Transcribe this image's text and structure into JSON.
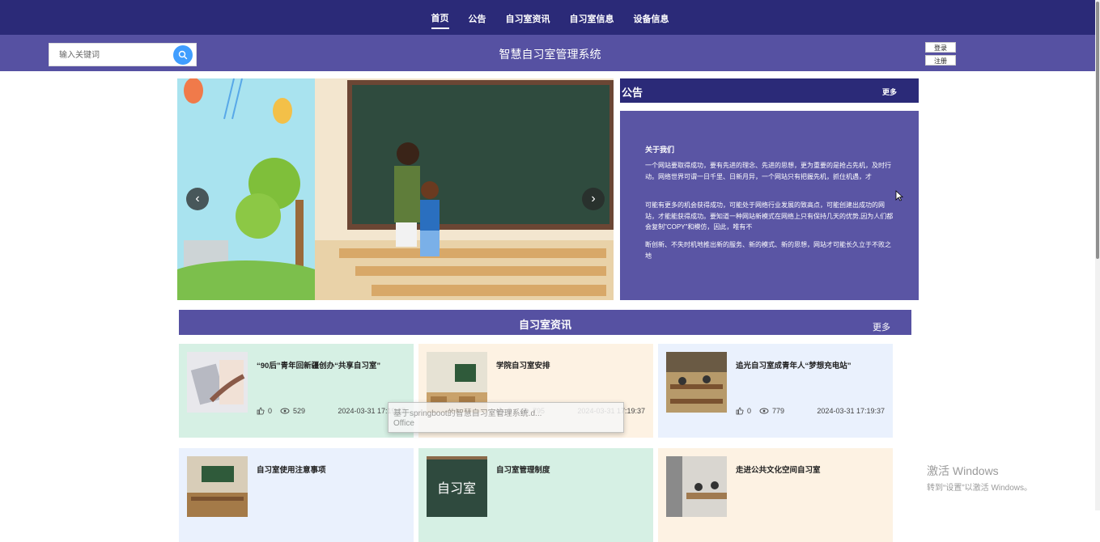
{
  "nav": {
    "items": [
      {
        "label": "首页",
        "active": true
      },
      {
        "label": "公告"
      },
      {
        "label": "自习室资讯"
      },
      {
        "label": "自习室信息"
      },
      {
        "label": "设备信息"
      }
    ]
  },
  "header": {
    "search_placeholder": "输入关键词",
    "title": "智慧自习室管理系统",
    "login_label": "登录",
    "register_label": "注册"
  },
  "banner": {
    "prev": "‹",
    "next": "›"
  },
  "notice": {
    "title": "公告",
    "more": "更多",
    "item_title": "关于我们",
    "paragraph1": "一个网站要取得成功，要有先进的理念、先进的思想，更为重要的是抢占先机，及时行动。网络世界可谓一日千里、日新月异，一个网站只有把握先机，抓住机遇，才",
    "paragraph2": "可能有更多的机会获得成功，可能处于网络行业发展的致高点，可能创建出成功的网站，才能能获得成功。要知道一种网站新模式在网络上只有保持几天的优势,因为人们都会复制\"COPY\"和模仿，因此，唯有不",
    "paragraph3": "断创新、不失时机地推出新的服务、新的模式、新的思想，网站才可能长久立于不败之地"
  },
  "news": {
    "title": "自习室资讯",
    "more": "更多",
    "cards": [
      {
        "title": "“90后”青年回新疆创办“共享自习室”",
        "likes": "0",
        "views": "529",
        "date": "2024-03-31 17:19:37"
      },
      {
        "title": "学院自习室安排",
        "likes": "0",
        "views": "795",
        "date": "2024-03-31 17:19:37"
      },
      {
        "title": "追光自习室成青年人“梦想充电站”",
        "likes": "0",
        "views": "779",
        "date": "2024-03-31 17:19:37"
      },
      {
        "title": "自习室使用注意事项",
        "likes": "",
        "views": "",
        "date": ""
      },
      {
        "title": "自习室管理制度",
        "likes": "",
        "views": "",
        "date": ""
      },
      {
        "title": "走进公共文化空间自习室",
        "likes": "",
        "views": "",
        "date": ""
      }
    ]
  },
  "tooltip": {
    "line1": "基于springboot的智慧自习室管理系统.d...",
    "line2": "Office"
  },
  "watermark": {
    "line1": "激活 Windows",
    "line2": "转到“设置”以激活 Windows。"
  },
  "colors": {
    "nav_bg": "#2b2a78",
    "header_bg": "#5651a2",
    "search_button": "#409eff"
  }
}
